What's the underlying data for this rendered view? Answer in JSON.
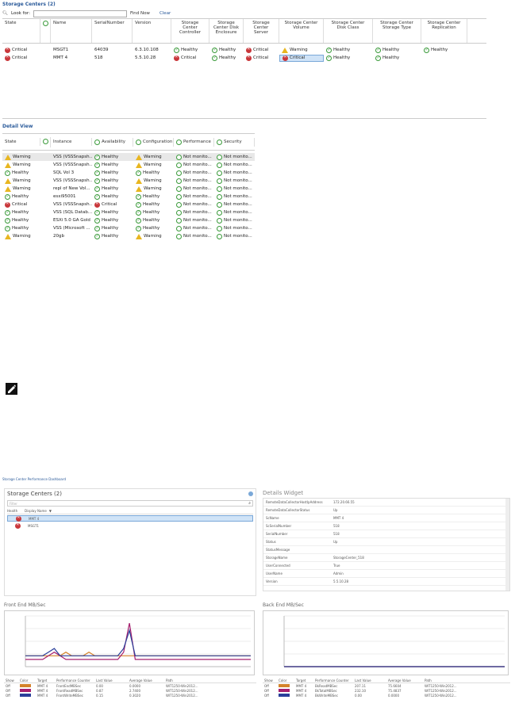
{
  "storage_centers": {
    "title": "Storage Centers (2)",
    "search": {
      "look_for_label": "Look for:",
      "find_now": "Find Now",
      "clear": "Clear",
      "value": ""
    },
    "columns": [
      "State",
      "",
      "Name",
      "SerialNumber",
      "Version",
      "Storage Center Controller",
      "Storage Center Disk Enclosure",
      "Storage Center Server",
      "Storage Center Volume",
      "Storage Center Disk Class",
      "Storage Center Storage Type",
      "Storage Center Replication"
    ],
    "rows": [
      {
        "state": "Critical",
        "state_icon": "critical",
        "name": "MSGT1",
        "serial": "64039",
        "version": "6.3.10.108",
        "controller": "Healthy",
        "controller_icon": "ok",
        "enclosure": "Healthy",
        "enclosure_icon": "ok",
        "server": "Critical",
        "server_icon": "critical",
        "volume": "Warning",
        "volume_icon": "warning",
        "diskclass": "Healthy",
        "diskclass_icon": "ok",
        "storagetype": "Healthy",
        "storagetype_icon": "ok",
        "replication": "Healthy",
        "replication_icon": "ok"
      },
      {
        "state": "Critical",
        "state_icon": "critical",
        "name": "MMT 4",
        "serial": "518",
        "version": "5.5.10.28",
        "controller": "Critical",
        "controller_icon": "critical",
        "enclosure": "Healthy",
        "enclosure_icon": "ok",
        "server": "Critical",
        "server_icon": "critical",
        "volume": "Critical",
        "volume_icon": "critical",
        "diskclass": "Healthy",
        "diskclass_icon": "ok",
        "storagetype": "Healthy",
        "storagetype_icon": "ok",
        "replication": "",
        "replication_icon": ""
      }
    ]
  },
  "detail_view": {
    "title": "Detail View",
    "columns": [
      "State",
      "",
      "Instance",
      "Availability",
      "Configuration",
      "Performance",
      "Security"
    ],
    "rows": [
      {
        "state": "Warning",
        "state_icon": "warning",
        "instance": "VSS (VSSSnapsh...",
        "availability": "Healthy",
        "availability_icon": "ok",
        "configuration": "Warning",
        "configuration_icon": "warning",
        "performance": "Not monito...",
        "security": "Not monito..."
      },
      {
        "state": "Warning",
        "state_icon": "warning",
        "instance": "VSS (VSSSnapsh...",
        "availability": "Healthy",
        "availability_icon": "ok",
        "configuration": "Warning",
        "configuration_icon": "warning",
        "performance": "Not monito...",
        "security": "Not monito..."
      },
      {
        "state": "Healthy",
        "state_icon": "ok",
        "instance": "SQL Vol 3",
        "availability": "Healthy",
        "availability_icon": "ok",
        "configuration": "Healthy",
        "configuration_icon": "ok",
        "performance": "Not monito...",
        "security": "Not monito..."
      },
      {
        "state": "Warning",
        "state_icon": "warning",
        "instance": "VSS (VSSSnapsh...",
        "availability": "Healthy",
        "availability_icon": "ok",
        "configuration": "Warning",
        "configuration_icon": "warning",
        "performance": "Not monito...",
        "security": "Not monito..."
      },
      {
        "state": "Warning",
        "state_icon": "warning",
        "instance": "repl of New Vol...",
        "availability": "Healthy",
        "availability_icon": "ok",
        "configuration": "Warning",
        "configuration_icon": "warning",
        "performance": "Not monito...",
        "security": "Not monito..."
      },
      {
        "state": "Healthy",
        "state_icon": "ok",
        "instance": "esxi95001",
        "availability": "Healthy",
        "availability_icon": "ok",
        "configuration": "Healthy",
        "configuration_icon": "ok",
        "performance": "Not monito...",
        "security": "Not monito..."
      },
      {
        "state": "Critical",
        "state_icon": "critical",
        "instance": "VSS (VSSSnapsh...",
        "availability": "Critical",
        "availability_icon": "critical",
        "configuration": "Healthy",
        "configuration_icon": "ok",
        "performance": "Not monito...",
        "security": "Not monito..."
      },
      {
        "state": "Healthy",
        "state_icon": "ok",
        "instance": "VSS (SQL Datab...",
        "availability": "Healthy",
        "availability_icon": "ok",
        "configuration": "Healthy",
        "configuration_icon": "ok",
        "performance": "Not monito...",
        "security": "Not monito..."
      },
      {
        "state": "Healthy",
        "state_icon": "ok",
        "instance": "ESXi 5.0 GA Gold",
        "availability": "Healthy",
        "availability_icon": "ok",
        "configuration": "Healthy",
        "configuration_icon": "ok",
        "performance": "Not monito...",
        "security": "Not monito..."
      },
      {
        "state": "Healthy",
        "state_icon": "ok",
        "instance": "VSS (Microsoft ...",
        "availability": "Healthy",
        "availability_icon": "ok",
        "configuration": "Healthy",
        "configuration_icon": "ok",
        "performance": "Not monito...",
        "security": "Not monito..."
      },
      {
        "state": "Warning",
        "state_icon": "warning",
        "instance": "20gb",
        "availability": "Healthy",
        "availability_icon": "ok",
        "configuration": "Warning",
        "configuration_icon": "warning",
        "performance": "Not monito...",
        "security": "Not monito..."
      }
    ]
  },
  "dashboard": {
    "title": "Storage Center Performance Dashboard",
    "sc_panel": {
      "title": "Storage Centers (2)",
      "filter_placeholder": "Filter",
      "col_health": "Health",
      "col_name": "Display Name",
      "items": [
        "MMT 4",
        "MSGT1"
      ]
    },
    "details": {
      "title": "Details Widget",
      "rows": [
        {
          "k": "RemoteDataCollectorHostIpAddress",
          "v": "172.20.66.55"
        },
        {
          "k": "RemoteDataCollectorStatus",
          "v": "Up"
        },
        {
          "k": "ScName",
          "v": "MMT 4"
        },
        {
          "k": "ScSerialNumber",
          "v": "518"
        },
        {
          "k": "SerialNumber",
          "v": "518"
        },
        {
          "k": "Status",
          "v": "Up"
        },
        {
          "k": "StatusMessage",
          "v": ""
        },
        {
          "k": "StorageName",
          "v": "StorageCenter_518"
        },
        {
          "k": "UserConnected",
          "v": "True"
        },
        {
          "k": "UserName",
          "v": "Admin"
        },
        {
          "k": "Version",
          "v": "5.5.10.28"
        }
      ]
    },
    "front_chart_title": "Front End MB/Sec",
    "back_chart_title": "Back End MB/Sec",
    "legend_columns": [
      "Show",
      "Color",
      "Target",
      "Performance Counter",
      "Last Value",
      "Average Value",
      "Path"
    ],
    "front_legend": [
      {
        "show": "Off",
        "color": "#d4832a",
        "target": "MMT 4",
        "counter": "FrontEndMBSec",
        "last": "0.00",
        "avg": "0.0000",
        "path": "WIT1250-Win2012..."
      },
      {
        "show": "Off",
        "color": "#a6206e",
        "target": "MMT 4",
        "counter": "FrontReadMBSec",
        "last": "0.87",
        "avg": "2.7400",
        "path": "WIT1250-Win2012..."
      },
      {
        "show": "Off",
        "color": "#2a3f9a",
        "target": "MMT 4",
        "counter": "FrontWriteMBSec",
        "last": "0.15",
        "avg": "0.3020",
        "path": "WIT1250-Win2012..."
      }
    ],
    "back_legend": [
      {
        "show": "Off",
        "color": "#d4832a",
        "target": "MMT 4",
        "counter": "BkReadMBSec",
        "last": "207.11",
        "avg": "75.6604",
        "path": "WIT1250-Win2012..."
      },
      {
        "show": "Off",
        "color": "#a6206e",
        "target": "MMT 4",
        "counter": "BkTotalMBSec",
        "last": "232.10",
        "avg": "75.4837",
        "path": "WIT1250-Win2012..."
      },
      {
        "show": "Off",
        "color": "#2a3f9a",
        "target": "MMT 4",
        "counter": "BkWriteMBSec",
        "last": "0.00",
        "avg": "0.0000",
        "path": "WIT1250-Win2012..."
      }
    ],
    "front_series": [
      {
        "color": "#d4832a",
        "values": [
          3,
          3,
          3,
          3,
          3,
          3,
          3,
          4,
          3,
          3,
          3,
          4,
          3,
          3,
          3,
          3,
          3,
          3,
          3,
          3,
          3,
          3,
          3,
          3,
          3,
          3,
          3,
          3,
          3,
          3,
          3,
          3,
          3,
          3,
          3,
          3,
          3,
          3,
          3,
          3
        ]
      },
      {
        "color": "#a6206e",
        "values": [
          2,
          2,
          2,
          2,
          3,
          4,
          3,
          2,
          2,
          2,
          2,
          2,
          2,
          2,
          2,
          2,
          2,
          4,
          12,
          2,
          2,
          2,
          2,
          2,
          2,
          2,
          2,
          2,
          2,
          2,
          2,
          2,
          2,
          2,
          2,
          2,
          2,
          2,
          2,
          2
        ]
      },
      {
        "color": "#2a3f9a",
        "values": [
          3,
          3,
          3,
          3,
          4,
          5,
          3,
          3,
          3,
          3,
          3,
          3,
          3,
          3,
          3,
          3,
          3,
          5,
          10,
          3,
          3,
          3,
          3,
          3,
          3,
          3,
          3,
          3,
          3,
          3,
          3,
          3,
          3,
          3,
          3,
          3,
          3,
          3,
          3,
          3
        ]
      }
    ],
    "back_series": [
      {
        "color": "#d4832a",
        "values": [
          0,
          0,
          0,
          0,
          0,
          0,
          0,
          0,
          0,
          0,
          0,
          0,
          0,
          0,
          0,
          0,
          0,
          0,
          0,
          0,
          0,
          0,
          0,
          0,
          0,
          0,
          0,
          0,
          0,
          0,
          0,
          0,
          0,
          0,
          0,
          0,
          0,
          0,
          0,
          0
        ]
      },
      {
        "color": "#a6206e",
        "values": [
          0,
          0,
          0,
          0,
          0,
          0,
          0,
          0,
          0,
          0,
          0,
          0,
          0,
          0,
          0,
          0,
          0,
          0,
          0,
          0,
          0,
          0,
          0,
          0,
          0,
          0,
          0,
          0,
          0,
          0,
          0,
          0,
          0,
          0,
          0,
          0,
          0,
          0,
          0,
          0
        ]
      },
      {
        "color": "#2a3f9a",
        "values": [
          0,
          0,
          0,
          0,
          0,
          0,
          0,
          0,
          0,
          0,
          0,
          0,
          0,
          0,
          0,
          0,
          0,
          0,
          0,
          0,
          0,
          0,
          0,
          0,
          0,
          0,
          0,
          0,
          0,
          0,
          0,
          0,
          0,
          0,
          0,
          0,
          0,
          0,
          0,
          0
        ]
      }
    ]
  }
}
